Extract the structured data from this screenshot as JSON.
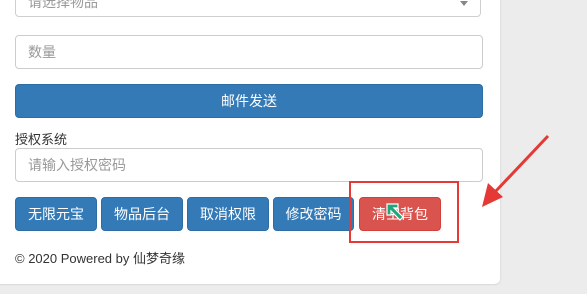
{
  "form": {
    "item_select_placeholder": "请选择物品",
    "quantity_placeholder": "数量",
    "send_mail_label": "邮件发送",
    "auth_section_label": "授权系统",
    "auth_password_placeholder": "请输入授权密码"
  },
  "actions": {
    "unlimited_yuanbao_label": "无限元宝",
    "item_backend_label": "物品后台",
    "cancel_permission_label": "取消权限",
    "change_password_label": "修改密码",
    "clear_backpack_label": "清空背包"
  },
  "footer": {
    "text": "© 2020 Powered by 仙梦奇缘"
  },
  "colors": {
    "primary": "#337ab7",
    "danger": "#d9534f",
    "annotation": "#e53935",
    "cursor": "#1fa67a"
  },
  "icons": {
    "select_caret": "caret-down-icon",
    "pointer_arrow": "red-arrow-icon",
    "cursor": "hand-cursor-icon"
  }
}
